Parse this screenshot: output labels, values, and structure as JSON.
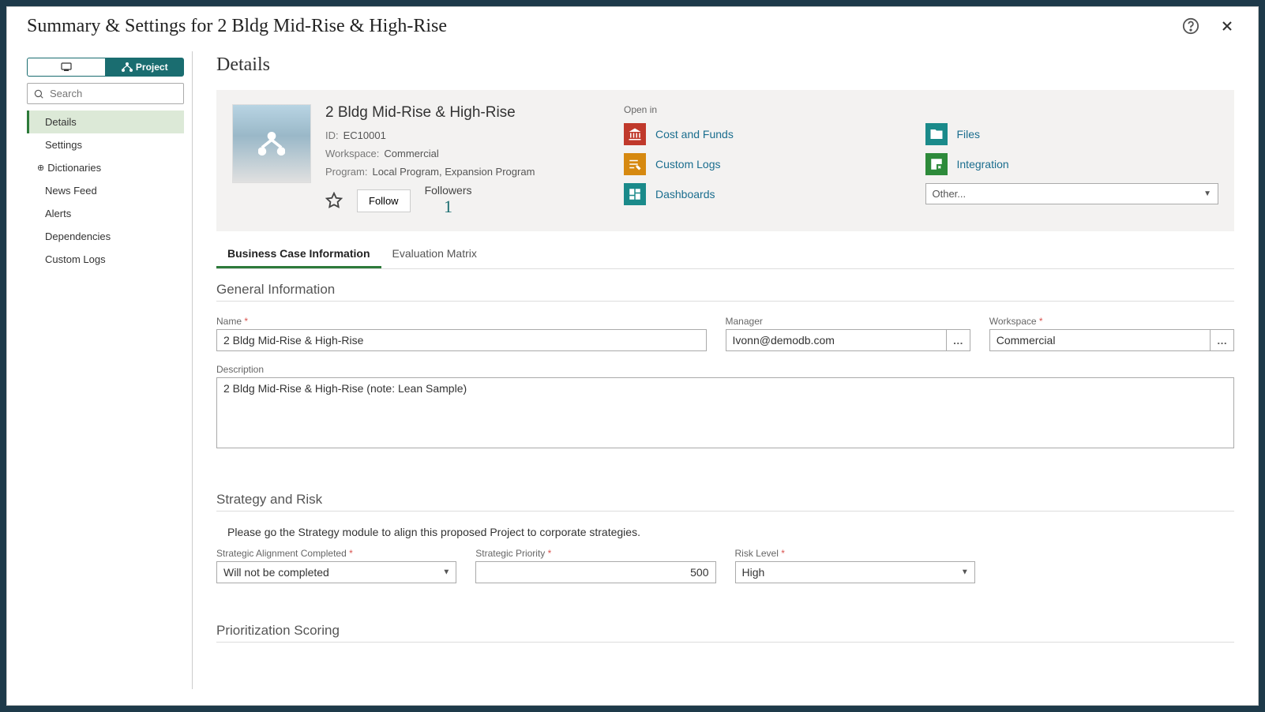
{
  "modal": {
    "title": "Summary & Settings for 2 Bldg Mid-Rise & High-Rise"
  },
  "sidebar": {
    "scope_left": "",
    "scope_right": "Project",
    "search_placeholder": "Search",
    "nav": [
      {
        "label": "Details",
        "active": true
      },
      {
        "label": "Settings"
      },
      {
        "label": "Dictionaries",
        "expandable": true
      },
      {
        "label": "News Feed"
      },
      {
        "label": "Alerts"
      },
      {
        "label": "Dependencies"
      },
      {
        "label": "Custom Logs"
      }
    ]
  },
  "details": {
    "heading": "Details",
    "project_name": "2 Bldg Mid-Rise & High-Rise",
    "id_label": "ID:",
    "id_value": "EC10001",
    "workspace_label": "Workspace:",
    "workspace_value": "Commercial",
    "program_label": "Program:",
    "program_value": "Local Program, Expansion Program",
    "follow_btn": "Follow",
    "followers_label": "Followers",
    "followers_count": "1",
    "openin_label": "Open in",
    "openin": {
      "cost_funds": "Cost and Funds",
      "files": "Files",
      "custom_logs": "Custom Logs",
      "integration": "Integration",
      "dashboards": "Dashboards",
      "other": "Other..."
    }
  },
  "tabs": {
    "business_case": "Business Case Information",
    "evaluation_matrix": "Evaluation Matrix"
  },
  "general": {
    "heading": "General Information",
    "name_label": "Name",
    "name_value": "2 Bldg Mid-Rise & High-Rise",
    "manager_label": "Manager",
    "manager_value": "Ivonn@demodb.com",
    "workspace_label": "Workspace",
    "workspace_value": "Commercial",
    "description_label": "Description",
    "description_value": "2 Bldg Mid-Rise & High-Rise (note: Lean Sample)"
  },
  "strategy": {
    "heading": "Strategy and Risk",
    "help": "Please go the Strategy module to align this proposed Project to corporate strategies.",
    "alignment_label": "Strategic Alignment Completed",
    "alignment_value": "Will not be completed",
    "priority_label": "Strategic Priority",
    "priority_value": "500",
    "risk_label": "Risk Level",
    "risk_value": "High"
  },
  "prioritization": {
    "heading": "Prioritization Scoring"
  }
}
